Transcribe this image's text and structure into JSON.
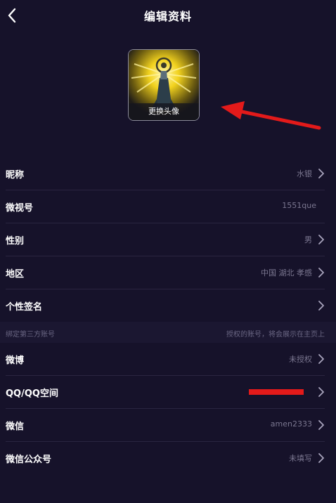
{
  "header": {
    "title": "编辑资料"
  },
  "avatar": {
    "caption": "更换头像"
  },
  "profile_rows": [
    {
      "label": "昵称",
      "value": "水银"
    },
    {
      "label": "微视号",
      "value": "1551que"
    },
    {
      "label": "性别",
      "value": "男"
    },
    {
      "label": "地区",
      "value": "中国 湖北 孝感"
    },
    {
      "label": "个性签名",
      "value": ""
    }
  ],
  "third_party": {
    "title": "绑定第三方账号",
    "note": "授权的账号，将会展示在主页上"
  },
  "account_rows": [
    {
      "label": "微博",
      "value": "未授权"
    },
    {
      "label": "QQ/QQ空间",
      "value": ""
    },
    {
      "label": "微信",
      "value": "amen2333"
    },
    {
      "label": "微信公众号",
      "value": "未填写"
    }
  ],
  "colors": {
    "background": "#16122a",
    "divider": "#2a2540",
    "muted_text": "#7b7790",
    "annotation_red": "#e31a1a"
  },
  "icons": {
    "back": "chevron-left-icon",
    "row_arrow": "chevron-right-icon"
  }
}
